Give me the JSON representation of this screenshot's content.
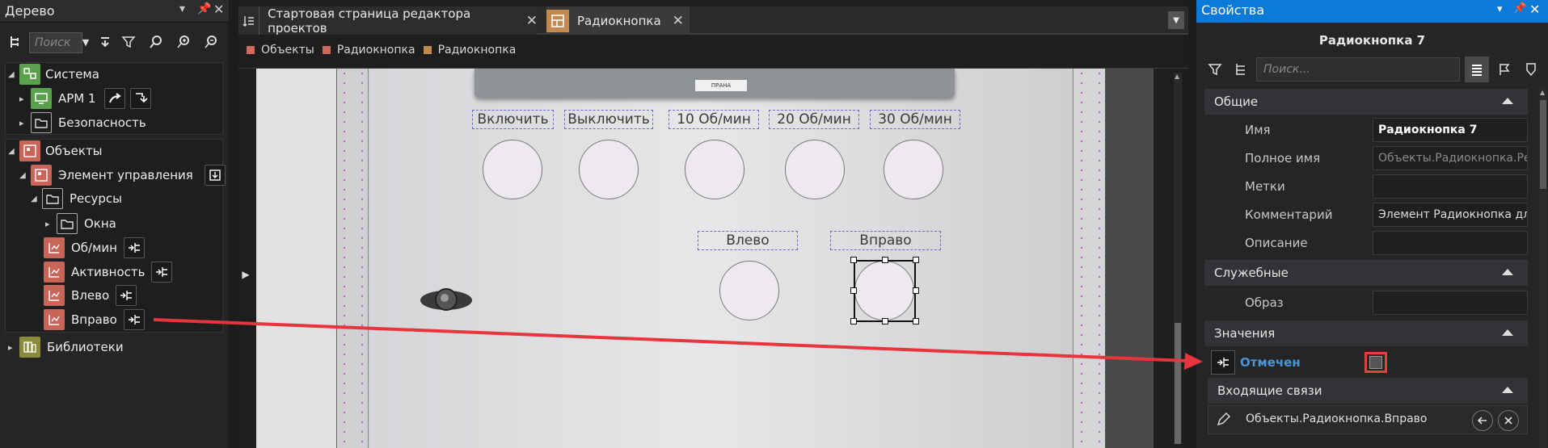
{
  "tree": {
    "title": "Дерево",
    "search_placeholder": "Поиск",
    "nodes": [
      {
        "label": "Система"
      },
      {
        "label": "АРМ 1"
      },
      {
        "label": "Безопасность"
      },
      {
        "label": "Объекты"
      },
      {
        "label": "Элемент управления"
      },
      {
        "label": "Ресурсы"
      },
      {
        "label": "Окна"
      },
      {
        "label": "Об/мин"
      },
      {
        "label": "Активность"
      },
      {
        "label": "Влево"
      },
      {
        "label": "Вправо"
      },
      {
        "label": "Библиотеки"
      }
    ]
  },
  "editor": {
    "tabs": [
      {
        "label": "Стартовая страница редактора проектов"
      },
      {
        "label": "Радиокнопка"
      }
    ],
    "breadcrumbs": [
      {
        "label": "Объекты",
        "color": "#d06a5c"
      },
      {
        "label": "Радиокнопка",
        "color": "#d06a5c"
      },
      {
        "label": "Радиокнопка",
        "color": "#c08a50"
      }
    ],
    "panel_logo": "ПРАНА",
    "buttons_row1": [
      "Включить",
      "Выключить",
      "10 Об/мин",
      "20 Об/мин",
      "30 Об/мин"
    ],
    "buttons_row2": [
      "Влево",
      "Вправо"
    ]
  },
  "properties": {
    "title": "Свойства",
    "object_name": "Радиокнопка 7",
    "search_placeholder": "Поиск...",
    "sections": {
      "general": "Общие",
      "service": "Служебные",
      "values": "Значения",
      "incoming": "Входящие связи"
    },
    "general": {
      "name_label": "Имя",
      "name_value": "Радиокнопка 7",
      "fullname_label": "Полное имя",
      "fullname_value": "Объекты.Радиокнопка.Ресу",
      "tags_label": "Метки",
      "tags_value": "",
      "comment_label": "Комментарий",
      "comment_value": "Элемент Радиокнопка для",
      "desc_label": "Описание",
      "desc_value": ""
    },
    "service": {
      "image_label": "Образ",
      "image_value": ""
    },
    "values": {
      "checked_label": "Отмечен",
      "checked": false
    },
    "incoming_link": "Объекты.Радиокнопка.Вправо"
  },
  "colors": {
    "accent_blue": "#0a7ad8",
    "highlight_red": "#e84040",
    "arrow_red": "#e8353d"
  }
}
